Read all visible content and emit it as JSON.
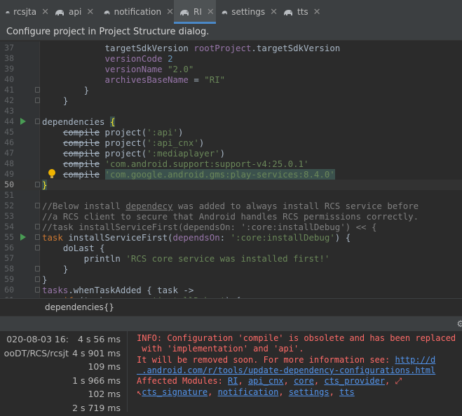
{
  "tabs": [
    {
      "label": "rcsjta",
      "active": false
    },
    {
      "label": "api",
      "active": false
    },
    {
      "label": "notification",
      "active": false
    },
    {
      "label": "RI",
      "active": true
    },
    {
      "label": "settings",
      "active": false
    },
    {
      "label": "tts",
      "active": false
    }
  ],
  "banner": {
    "text": "Configure project in Project Structure dialog."
  },
  "editor": {
    "current_line": 50,
    "lines": [
      {
        "n": "37",
        "tokens": [
          [
            "            ",
            ""
          ],
          [
            "targetSdkVersion ",
            ""
          ],
          [
            "rootProject",
            "prop"
          ],
          [
            ".targetSdkVersion",
            ""
          ]
        ]
      },
      {
        "n": "38",
        "tokens": [
          [
            "            ",
            ""
          ],
          [
            "versionCode ",
            "prop"
          ],
          [
            "2",
            "num"
          ]
        ]
      },
      {
        "n": "39",
        "tokens": [
          [
            "            ",
            ""
          ],
          [
            "versionName ",
            "prop"
          ],
          [
            "\"2.0\"",
            "str"
          ]
        ]
      },
      {
        "n": "40",
        "tokens": [
          [
            "            ",
            ""
          ],
          [
            "archivesBaseName",
            "prop"
          ],
          [
            " = ",
            ""
          ],
          [
            "\"RI\"",
            "str"
          ]
        ]
      },
      {
        "n": "41",
        "tokens": [
          [
            "        }",
            ""
          ]
        ]
      },
      {
        "n": "42",
        "tokens": [
          [
            "    }",
            ""
          ]
        ]
      },
      {
        "n": "43",
        "tokens": [
          [
            "",
            ""
          ]
        ]
      },
      {
        "n": "44",
        "tokens": [
          [
            "dependencies ",
            ""
          ],
          [
            "{",
            "brace"
          ]
        ]
      },
      {
        "n": "45",
        "tokens": [
          [
            "    ",
            ""
          ],
          [
            "compile",
            "strike"
          ],
          [
            " project(",
            ""
          ],
          [
            "':api'",
            "str"
          ],
          [
            ")",
            ""
          ]
        ]
      },
      {
        "n": "46",
        "tokens": [
          [
            "    ",
            ""
          ],
          [
            "compile",
            "strike"
          ],
          [
            " project(",
            ""
          ],
          [
            "':api_cnx'",
            "str"
          ],
          [
            ")",
            ""
          ]
        ]
      },
      {
        "n": "47",
        "tokens": [
          [
            "    ",
            ""
          ],
          [
            "compile",
            "strike"
          ],
          [
            " project(",
            ""
          ],
          [
            "':mediaplayer'",
            "str"
          ],
          [
            ")",
            ""
          ]
        ]
      },
      {
        "n": "48",
        "tokens": [
          [
            "    ",
            ""
          ],
          [
            "compile",
            "strike"
          ],
          [
            " ",
            ""
          ],
          [
            "'com.android.support:support-v4:25.0.1'",
            "str"
          ]
        ]
      },
      {
        "n": "49",
        "tokens": [
          [
            "    ",
            ""
          ],
          [
            "compile",
            "strike"
          ],
          [
            " ",
            ""
          ],
          [
            "'com.google.android.gms:play-services:8.4.0'",
            "strhl"
          ]
        ]
      },
      {
        "n": "50",
        "tokens": [
          [
            "}",
            "brace"
          ]
        ]
      },
      {
        "n": "51",
        "tokens": [
          [
            "",
            ""
          ]
        ]
      },
      {
        "n": "52",
        "tokens": [
          [
            "//Below install ",
            "cmt"
          ],
          [
            "dependecy",
            "cmtu"
          ],
          [
            " was added to always install RCS service before",
            "cmt"
          ]
        ]
      },
      {
        "n": "53",
        "tokens": [
          [
            "//a RCS client to secure that Android handles RCS permissions correctly.",
            "cmt"
          ]
        ]
      },
      {
        "n": "54",
        "tokens": [
          [
            "//task installServiceFirst(dependsOn: ':core:installDebug') << {",
            "cmt"
          ]
        ]
      },
      {
        "n": "55",
        "tokens": [
          [
            "task ",
            "kw"
          ],
          [
            "installServiceFirst(",
            ""
          ],
          [
            "dependsOn",
            "prop"
          ],
          [
            ": ",
            ""
          ],
          [
            "':core:installDebug'",
            "str"
          ],
          [
            ") {",
            ""
          ]
        ]
      },
      {
        "n": "56",
        "tokens": [
          [
            "    doLast {",
            ""
          ]
        ]
      },
      {
        "n": "57",
        "tokens": [
          [
            "        println ",
            ""
          ],
          [
            "'RCS core service was installed first!'",
            "str"
          ]
        ]
      },
      {
        "n": "58",
        "tokens": [
          [
            "    }",
            ""
          ]
        ]
      },
      {
        "n": "59",
        "tokens": [
          [
            "}",
            ""
          ]
        ]
      },
      {
        "n": "60",
        "tokens": [
          [
            "tasks",
            "prop"
          ],
          [
            ".whenTaskAdded { task ->",
            ""
          ]
        ]
      },
      {
        "n": "61",
        "tokens": [
          [
            "    ",
            ""
          ],
          [
            "if",
            "kw"
          ],
          [
            " (task.name == ",
            ""
          ],
          [
            "'installDebug'",
            "str"
          ],
          [
            ") {",
            ""
          ]
        ]
      }
    ]
  },
  "breadcrumb": {
    "text": "dependencies{}"
  },
  "build": {
    "rows": [
      {
        "name": "020-08-03 16:",
        "time": "4 s 56 ms"
      },
      {
        "name": "ooDT/RCS/rcsjt",
        "time": "4 s 901 ms"
      },
      {
        "name": "",
        "time": "109 ms"
      },
      {
        "name": "",
        "time": "1 s 966 ms"
      },
      {
        "name": "",
        "time": "102 ms"
      },
      {
        "name": "",
        "time": "2 s 719 ms"
      }
    ],
    "output": [
      [
        [
          "INFO: Configuration 'compile' is obsolete and has been replaced",
          ""
        ]
      ],
      [
        [
          " with 'implementation' and 'api'.",
          ""
        ]
      ],
      [
        [
          "It will be removed soon. For more information see: ",
          ""
        ],
        [
          "http://d",
          "link"
        ]
      ],
      [
        [
          " .android.com/r/tools/update-dependency-configurations.html",
          "link"
        ]
      ],
      [
        [
          "Affected Modules: ",
          ""
        ],
        [
          "RI",
          "link"
        ],
        [
          ", ",
          ""
        ],
        [
          "api_cnx",
          "link"
        ],
        [
          ", ",
          ""
        ],
        [
          "core",
          "link"
        ],
        [
          ", ",
          ""
        ],
        [
          "cts_provider",
          "link"
        ],
        [
          ", ⤢",
          ""
        ]
      ],
      [
        [
          "↖",
          ""
        ],
        [
          "cts_signature",
          "link"
        ],
        [
          ", ",
          ""
        ],
        [
          "notification",
          "link"
        ],
        [
          ", ",
          ""
        ],
        [
          "settings",
          "link"
        ],
        [
          ", ",
          ""
        ],
        [
          "tts",
          "link"
        ]
      ]
    ]
  },
  "markers": {
    "run_lines": [
      "44",
      "55"
    ],
    "bulb_line": "49"
  }
}
